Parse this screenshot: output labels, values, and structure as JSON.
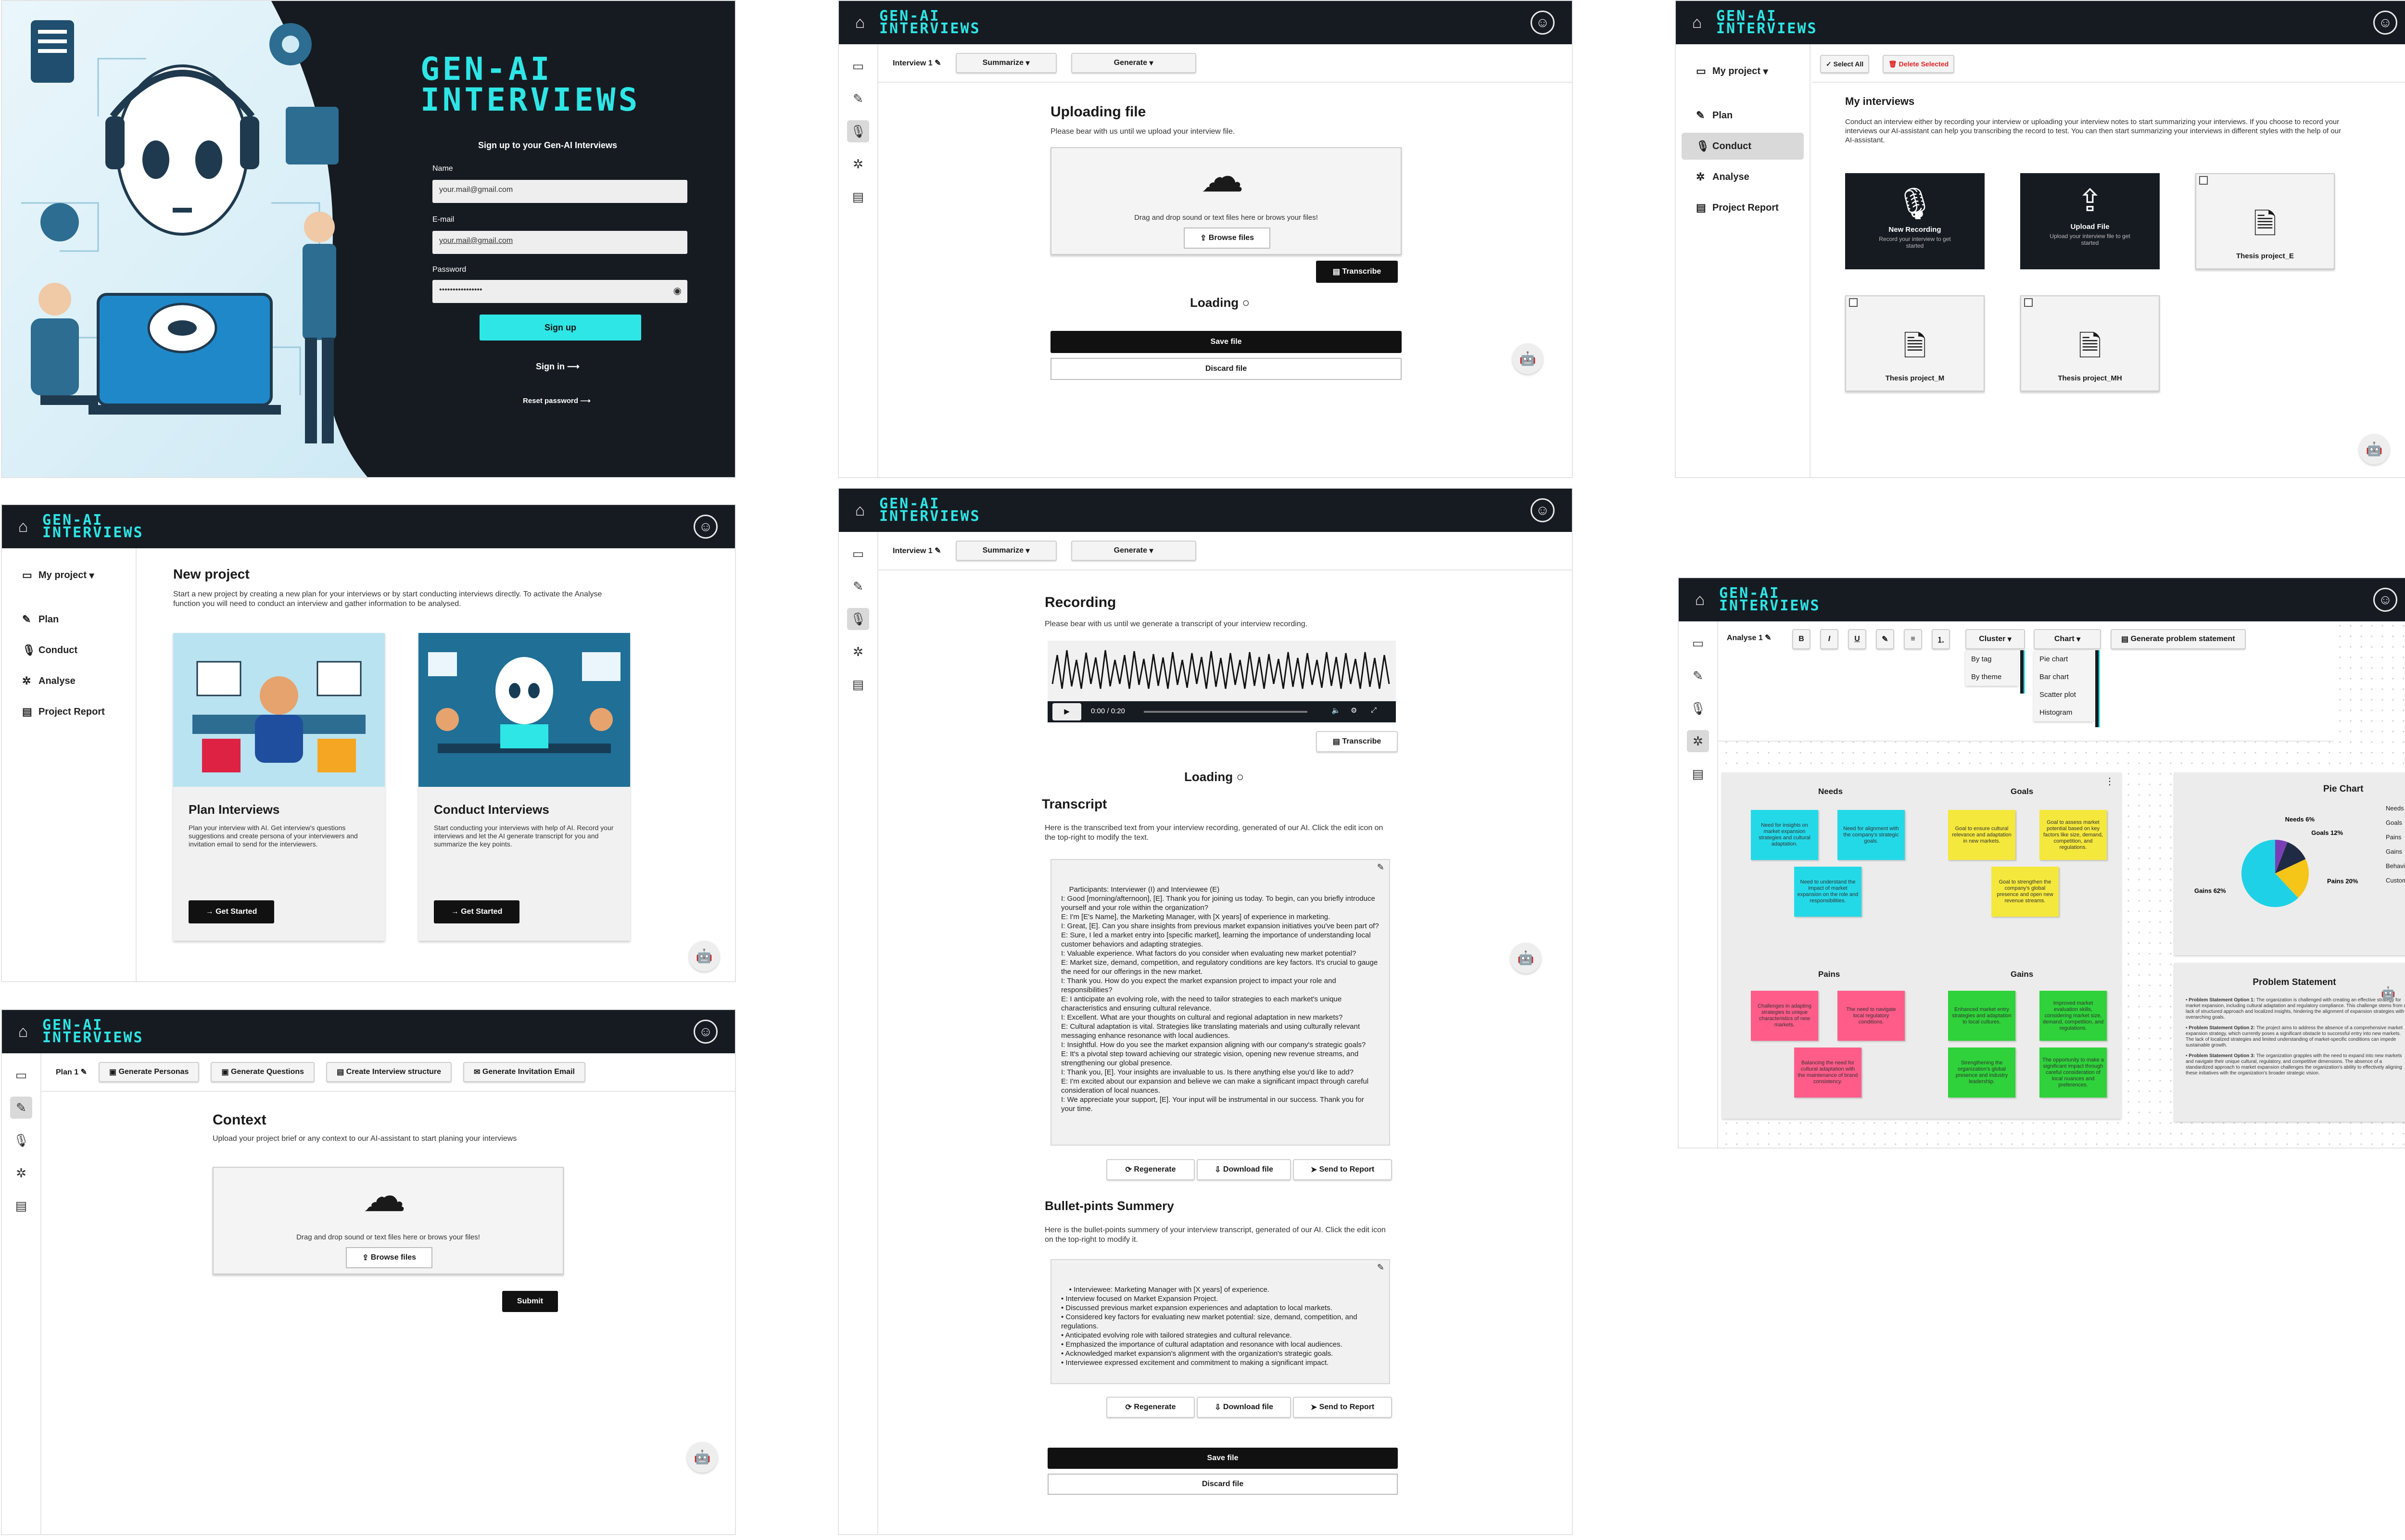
{
  "brand": {
    "logo_line1": "Gen-AI",
    "logo_line2": "Interviews",
    "accent": "#2ee6e6",
    "dark": "#161b22"
  },
  "signup": {
    "big_logo_line1": "Gen-AI",
    "big_logo_line2": "Interviews",
    "subtitle": "Sign up to your Gen-AI Interviews",
    "name_label": "Name",
    "name_value": "your.mail@gmail.com",
    "email_label": "E-mail",
    "email_value": "your.mail@gmail.com",
    "password_label": "Password",
    "password_value": "••••••••••••••••",
    "signup_button": "Sign up",
    "signin_link": "Sign in",
    "reset_link": "Reset password"
  },
  "nav": {
    "project": "My project",
    "plan": "Plan",
    "conduct": "Conduct",
    "analyse": "Analyse",
    "report": "Project Report"
  },
  "upload_panel": {
    "interview_tab": "Interview 1",
    "summarize": "Summarize",
    "generate": "Generate",
    "title": "Uploading file",
    "desc": "Please bear with us until we upload your interview file.",
    "drop_text": "Drag and drop sound or text files here or brows your files!",
    "browse": "Browse files",
    "transcribe": "Transcribe",
    "loading": "Loading",
    "save": "Save file",
    "discard": "Discard file"
  },
  "interviews_panel": {
    "select_all": "Select All",
    "delete_selected": "Delete Selected",
    "title": "My interviews",
    "desc": "Conduct an interview either by recording your interview or uploading your interview notes to start summarizing your interviews. If you choose to record your interviews our AI-assistant can help you transcribing the record to test. You can then start summarizing your interviews in different styles with the help of our AI-assistant.",
    "new_recording": "New  Recording",
    "new_recording_sub": "Record your interview to get started",
    "upload_file": "Upload File",
    "upload_file_sub": "Upload your interview file to get started",
    "files": [
      "Thesis project_E",
      "Thesis project_M",
      "Thesis project_MH"
    ]
  },
  "new_project": {
    "title": "New project",
    "desc": "Start a new project by creating a new plan for your interviews or by start conducting interviews directly. To activate the Analyse function you will need to conduct an interview and gather information to be analysed.",
    "plan_title": "Plan Interviews",
    "plan_desc": "Plan your interview with AI. Get interview's questions suggestions and create persona of your interviewers and invitation email to send for the interviewers.",
    "conduct_title": "Conduct Interviews",
    "conduct_desc": "Start conducting your interviews with help of AI. Record your interviews and let the AI generate transcript for you and summarize the key points.",
    "get_started": "Get Started"
  },
  "plan_panel": {
    "plan_tab": "Plan 1",
    "buttons": [
      "Generate Personas",
      "Generate Questions",
      "Create Interview structure",
      "Generate Invitation Email"
    ],
    "title": "Context",
    "desc": "Upload your project brief or any context to our AI-assistant to start planing your interviews",
    "drop_text": "Drag and drop sound or text files here or brows your files!",
    "browse": "Browse files",
    "submit": "Submit"
  },
  "recording_panel": {
    "interview_tab": "Interview 1",
    "summarize": "Summarize",
    "generate": "Generate",
    "title": "Recording",
    "desc": "Please bear with us until we generate a transcript of your interview recording.",
    "time": "0:00 / 0:20",
    "transcribe": "Transcribe",
    "loading": "Loading",
    "transcript_title": "Transcript",
    "transcript_desc": "Here is the transcribed text from your interview recording, generated of our AI. Click the edit icon on the top-right to modify the text.",
    "transcript_text": "Participants: Interviewer (I) and Interviewee (E)\nI: Good [morning/afternoon], [E]. Thank you for joining us today. To begin, can you briefly introduce yourself and your role within the organization?\nE: I'm [E's Name], the Marketing Manager, with [X years] of experience in marketing.\nI: Great, [E]. Can you share insights from previous market expansion initiatives you've been part of?\nE: Sure, I led a market entry into [specific market], learning the importance of understanding local customer behaviors and adapting strategies.\nI: Valuable experience. What factors do you consider when evaluating new market potential?\nE: Market size, demand, competition, and regulatory conditions are key factors. It's crucial to gauge the need for our offerings in the new market.\nI: Thank you. How do you expect the market expansion project to impact your role and responsibilities?\nE: I anticipate an evolving role, with the need to tailor strategies to each market's unique characteristics and ensuring cultural relevance.\nI: Excellent. What are your thoughts on cultural and regional adaptation in new markets?\nE: Cultural adaptation is vital. Strategies like translating materials and using culturally relevant messaging enhance resonance with local audiences.\nI: Insightful. How do you see the market expansion aligning with our company's strategic goals?\nE: It's a pivotal step toward achieving our strategic vision, opening new revenue streams, and strengthening our global presence.\nI: Thank you, [E]. Your insights are invaluable to us. Is there anything else you'd like to add?\nE: I'm excited about our expansion and believe we can make a significant impact through careful consideration of local nuances.\nI: We appreciate your support, [E]. Your input will be instrumental in our success. Thank you for your time.",
    "regenerate": "Regenerate",
    "download": "Download file",
    "send": "Send to Report",
    "summary_title": "Bullet-pints Summery",
    "summary_desc": "Here is the bullet-points summery of your interview transcript, generated of our AI. Click the edit icon on the top-right to modify it.",
    "summary_text": "• Interviewee: Marketing Manager with [X years] of experience.\n• Interview focused on Market Expansion Project.\n• Discussed previous market expansion experiences and adaptation to local markets.\n• Considered key factors for evaluating new market potential: size, demand, competition, and regulations.\n• Anticipated evolving role with tailored strategies and cultural relevance.\n• Emphasized the importance of cultural adaptation and resonance with local audiences.\n• Acknowledged market expansion's alignment with the organization's strategic goals.\n• Interviewee expressed excitement and commitment to making a significant impact.",
    "save": "Save file",
    "discard": "Discard file"
  },
  "analyse_panel": {
    "tab": "Analyse 1",
    "cluster": "Cluster",
    "cluster_options": [
      "By tag",
      "By theme"
    ],
    "chart": "Chart",
    "chart_options": [
      "Pie chart",
      "Bar chart",
      "Scatter plot",
      "Histogram"
    ],
    "generate_problem": "Generate problem statement",
    "needs": "Needs",
    "goals": "Goals",
    "pains": "Pains",
    "gains": "Gains",
    "needs_notes": [
      "Need for insights on market expansion strategies and cultural adaptation.",
      "Need for alignment with the company's strategic goals.",
      "Need to understand the impact of market expansion on the role and responsibilities."
    ],
    "goals_notes": [
      "Goal to ensure cultural relevance and adaptation in new markets.",
      "Goal to assess market potential based on key factors like size, demand, competition, and regulations.",
      "Goal to strengthen the company's global presence and open new revenue streams."
    ],
    "pains_notes": [
      "Challenges in adapting strategies to unique characteristics of new markets.",
      "The need to navigate local regulatory conditions.",
      "Balancing the need for cultural adaptation with the maintenance of brand consistency."
    ],
    "gains_notes": [
      "Enhanced market entry strategies and adaptation to local cultures.",
      "Improved market evaluation skills, considering market size, demand, competition, and regulations.",
      "Strengthening the organization's global presence and industry leadership.",
      "The opportunity to make a significant impact through careful consideration of local nuances and preferences."
    ],
    "pie_title": "Pie Chart",
    "pie_legend": [
      "Needs",
      "Goals",
      "Pains",
      "Gains",
      "Behaviour",
      "Custom"
    ],
    "problem_title": "Problem Statement",
    "problem_options": [
      {
        "label": "Problem Statement Option 1:",
        "text": "The organization is challenged with creating an effective strategy for market expansion, including cultural adaptation and regulatory compliance. This challenge stems from a lack of structured approach and localized insights, hindering the alignment of expansion strategies with overarching goals."
      },
      {
        "label": "Problem Statement Option 2:",
        "text": "The project aims to address the absence of a comprehensive market expansion strategy, which currently poses a significant obstacle to successful entry into new markets. The lack of localized strategies and limited understanding of market-specific conditions can impede sustainable growth."
      },
      {
        "label": "Problem Statement Option 3:",
        "text": "The organization grapples with the need to expand into new markets and navigate their unique cultural, regulatory, and competitive dimensions. The absence of a standardized approach to market expansion challenges the organization's ability to effectively aligning these initiatives with the organization's broader strategic vision."
      }
    ]
  },
  "chart_data": {
    "type": "pie",
    "title": "Pie Chart",
    "categories": [
      "Needs",
      "Goals",
      "Pains",
      "Gains"
    ],
    "values": [
      6,
      12,
      20,
      62
    ],
    "colors": [
      "#7b3fb5",
      "#1f2a44",
      "#f5c518",
      "#1fd1e6"
    ]
  }
}
